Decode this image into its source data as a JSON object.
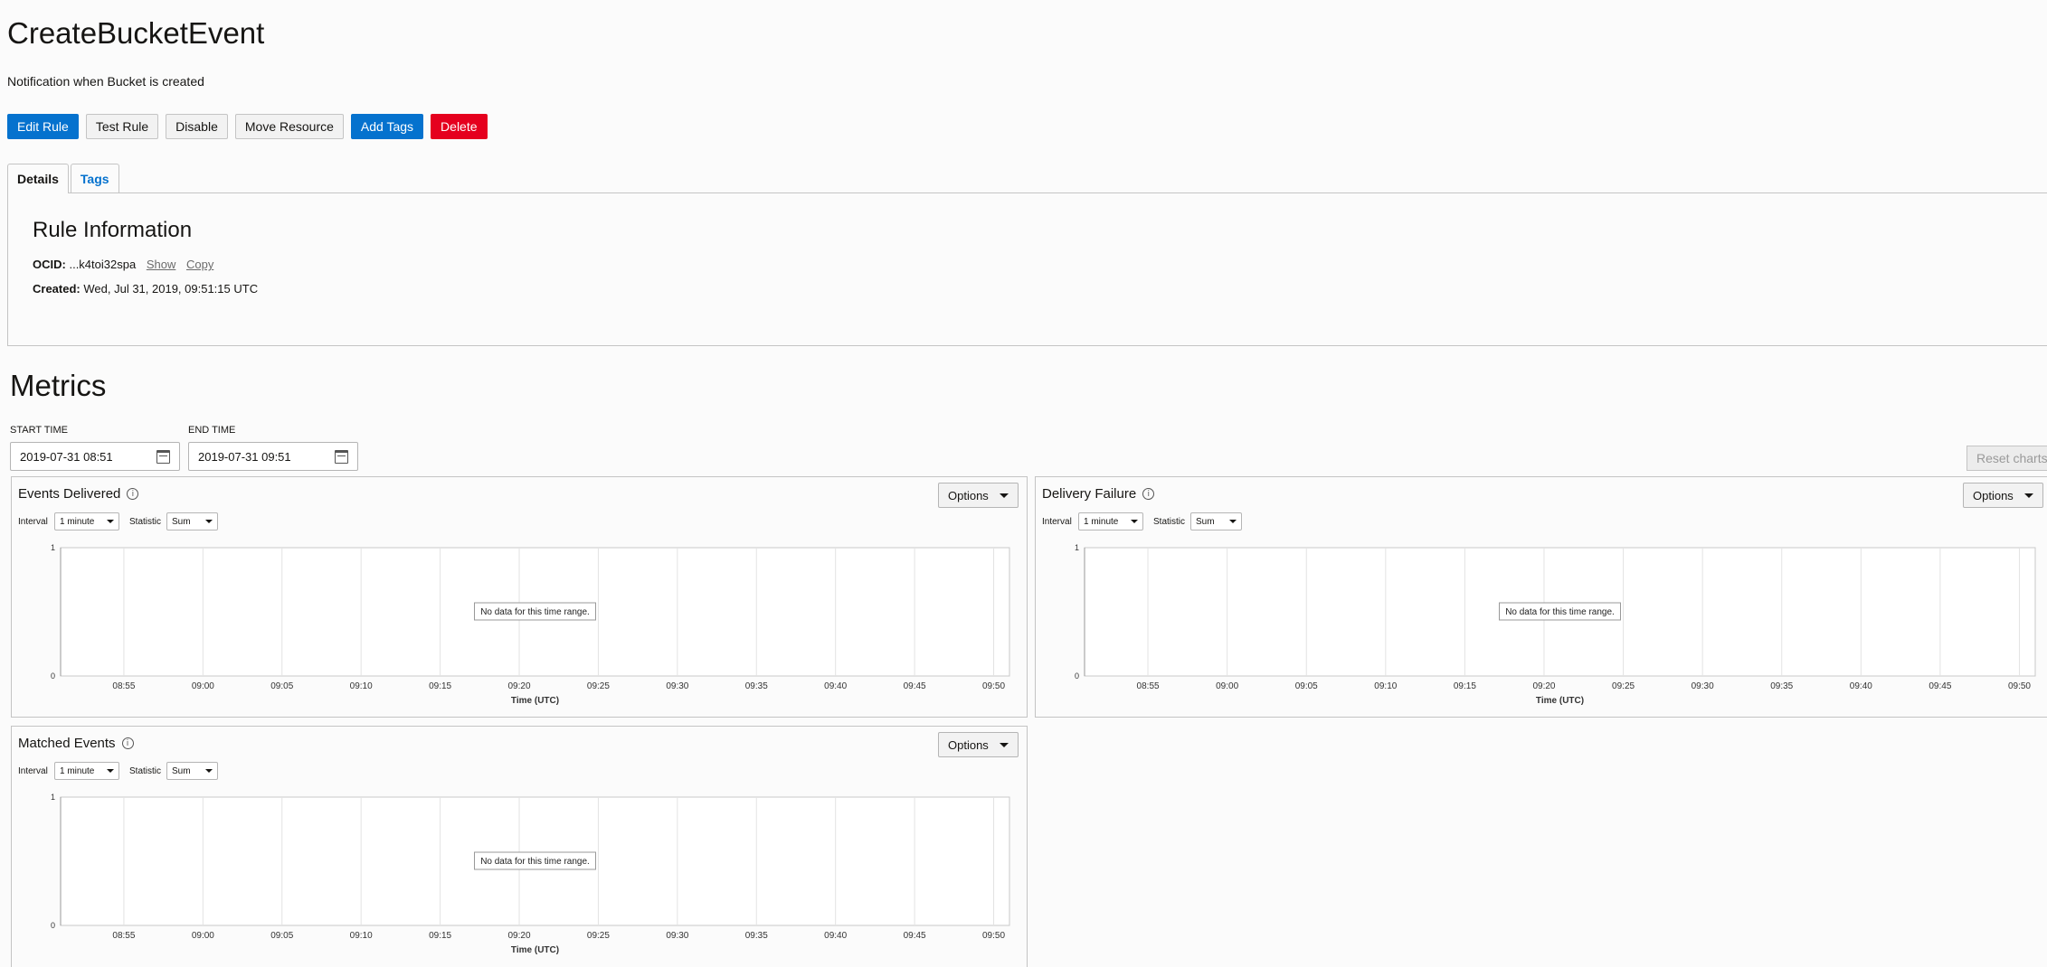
{
  "header": {
    "title": "CreateBucketEvent",
    "description": "Notification when Bucket is created"
  },
  "toolbar": {
    "edit_rule": "Edit Rule",
    "test_rule": "Test Rule",
    "disable": "Disable",
    "move_resource": "Move Resource",
    "add_tags": "Add Tags",
    "delete": "Delete"
  },
  "tabs": [
    {
      "label": "Details",
      "active": true
    },
    {
      "label": "Tags",
      "active": false
    }
  ],
  "rule_info": {
    "title": "Rule Information",
    "ocid_label": "OCID:",
    "ocid_value": "...k4toi32spa",
    "show_link": "Show",
    "copy_link": "Copy",
    "created_label": "Created:",
    "created_value": "Wed, Jul 31, 2019, 09:51:15 UTC"
  },
  "metrics": {
    "title": "Metrics",
    "start_label": "START TIME",
    "start_value": "2019-07-31 08:51",
    "end_label": "END TIME",
    "end_value": "2019-07-31 09:51",
    "reset_label": "Reset charts"
  },
  "panels": [
    {
      "title": "Events Delivered",
      "options": "Options",
      "interval_label": "Interval",
      "interval_value": "1 minute",
      "statistic_label": "Statistic",
      "statistic_value": "Sum"
    },
    {
      "title": "Delivery Failure",
      "options": "Options",
      "interval_label": "Interval",
      "interval_value": "1 minute",
      "statistic_label": "Statistic",
      "statistic_value": "Sum"
    },
    {
      "title": "Matched Events",
      "options": "Options",
      "interval_label": "Interval",
      "interval_value": "1 minute",
      "statistic_label": "Statistic",
      "statistic_value": "Sum"
    }
  ],
  "chart_data": [
    {
      "type": "line",
      "title": "Events Delivered",
      "xlabel": "Time (UTC)",
      "ylabel": "",
      "x_ticks": [
        "08:55",
        "09:00",
        "09:05",
        "09:10",
        "09:15",
        "09:20",
        "09:25",
        "09:30",
        "09:35",
        "09:40",
        "09:45",
        "09:50"
      ],
      "y_ticks": [
        "0",
        "1"
      ],
      "ylim": [
        0,
        1
      ],
      "series": [],
      "empty_message": "No data for this time range.",
      "grid": true
    },
    {
      "type": "line",
      "title": "Delivery Failure",
      "xlabel": "Time (UTC)",
      "ylabel": "",
      "x_ticks": [
        "08:55",
        "09:00",
        "09:05",
        "09:10",
        "09:15",
        "09:20",
        "09:25",
        "09:30",
        "09:35",
        "09:40",
        "09:45",
        "09:50"
      ],
      "y_ticks": [
        "0",
        "1"
      ],
      "ylim": [
        0,
        1
      ],
      "series": [],
      "empty_message": "No data for this time range.",
      "grid": true
    },
    {
      "type": "line",
      "title": "Matched Events",
      "xlabel": "Time (UTC)",
      "ylabel": "",
      "x_ticks": [
        "08:55",
        "09:00",
        "09:05",
        "09:10",
        "09:15",
        "09:20",
        "09:25",
        "09:30",
        "09:35",
        "09:40",
        "09:45",
        "09:50"
      ],
      "y_ticks": [
        "0",
        "1"
      ],
      "ylim": [
        0,
        1
      ],
      "series": [],
      "empty_message": "No data for this time range.",
      "grid": true
    }
  ],
  "colors": {
    "primary": "#0572ce",
    "danger": "#e5001e",
    "border": "#c4c4c4"
  }
}
